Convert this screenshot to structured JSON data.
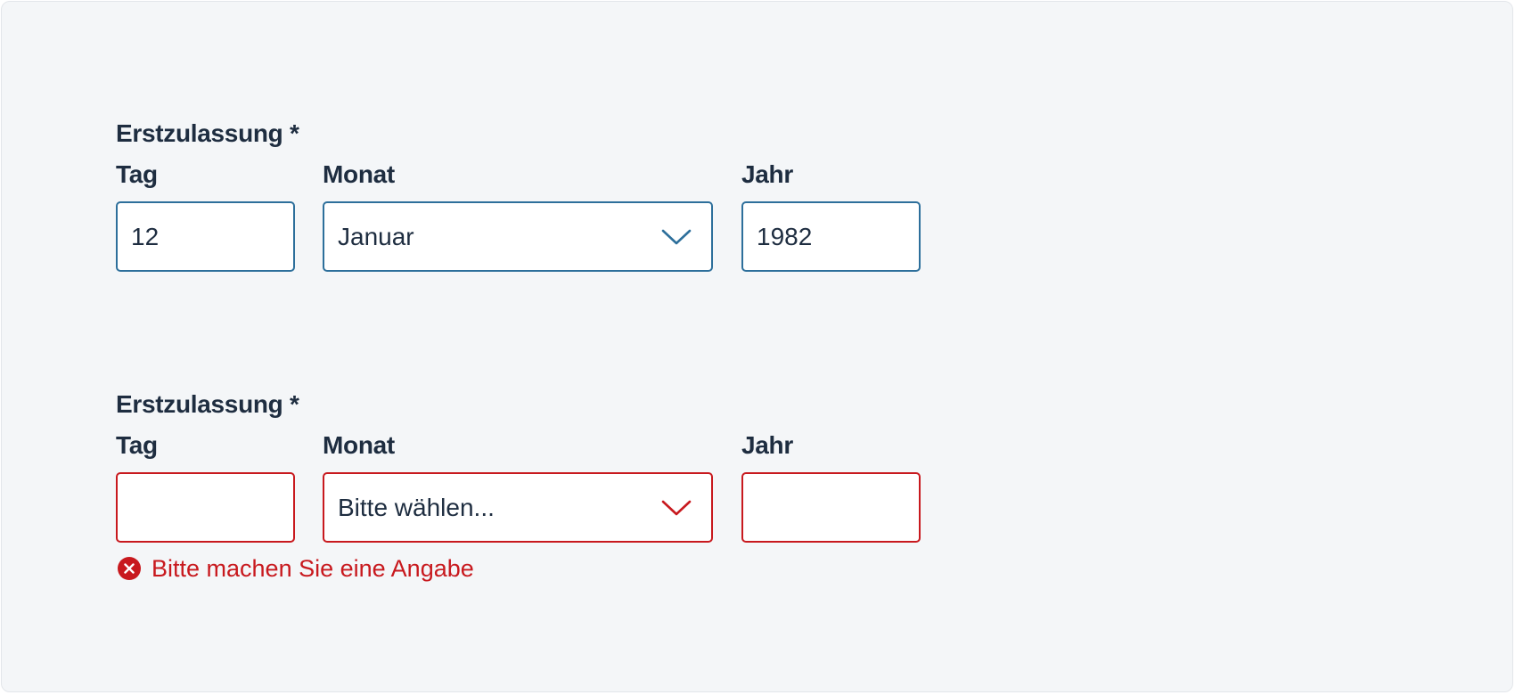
{
  "colors": {
    "text": "#1e2d40",
    "border_default": "#2d6f9b",
    "border_error": "#c8191e",
    "error_text": "#c8191e",
    "background": "#f4f6f8"
  },
  "group_valid": {
    "legend": "Erstzulassung *",
    "day": {
      "label": "Tag",
      "value": "12"
    },
    "month": {
      "label": "Monat",
      "value": "Januar",
      "icon": "chevron-down-icon"
    },
    "year": {
      "label": "Jahr",
      "value": "1982"
    }
  },
  "group_error": {
    "legend": "Erstzulassung *",
    "day": {
      "label": "Tag",
      "value": ""
    },
    "month": {
      "label": "Monat",
      "value": "Bitte wählen...",
      "icon": "chevron-down-icon"
    },
    "year": {
      "label": "Jahr",
      "value": ""
    },
    "error": {
      "icon": "error-circle-icon",
      "message": "Bitte machen Sie eine Angabe"
    }
  }
}
